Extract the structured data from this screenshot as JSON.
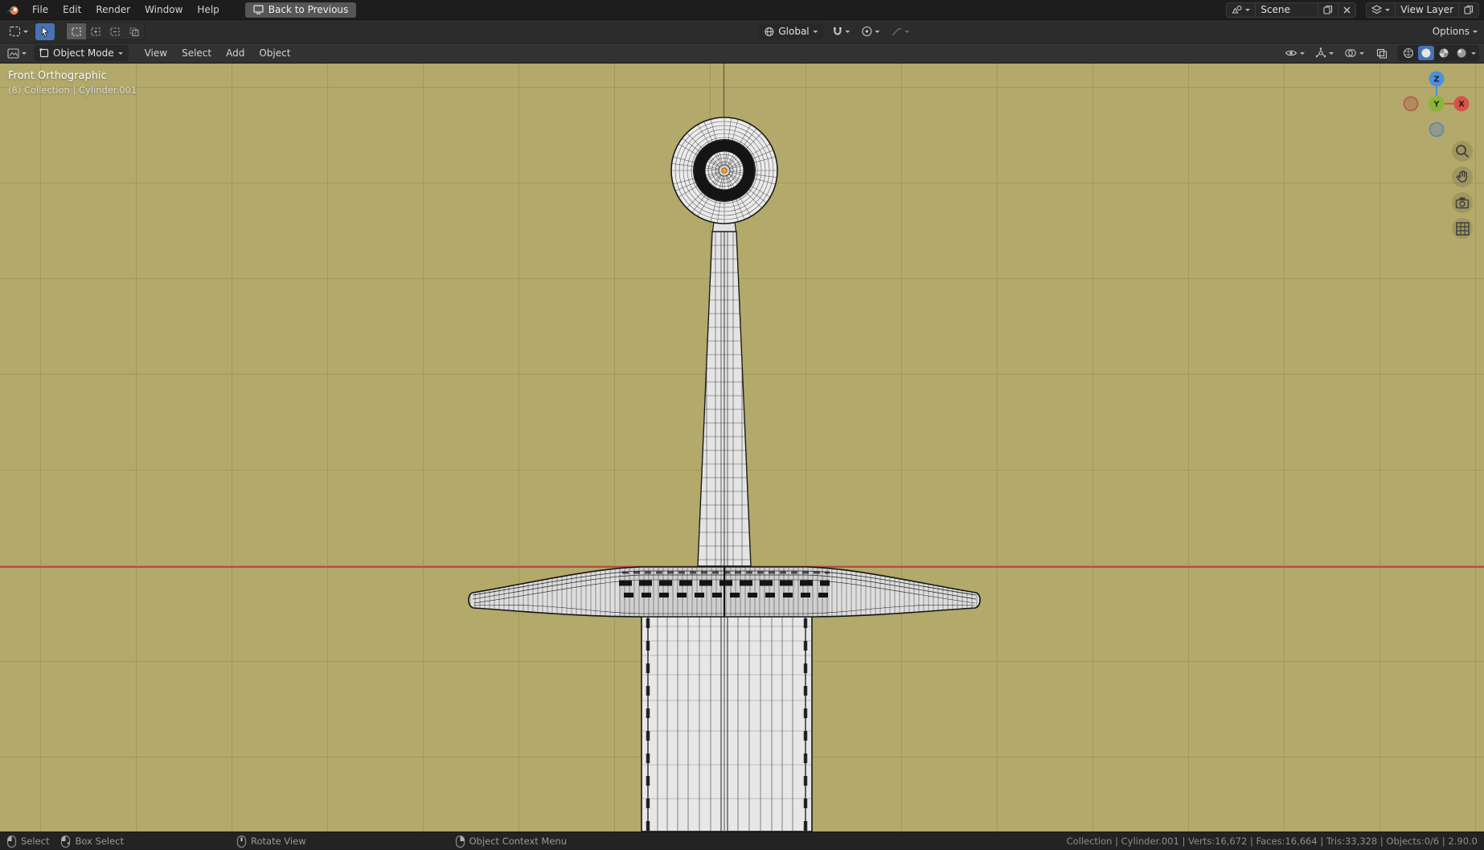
{
  "theme": {
    "topbar-bg": "#1d1d1d",
    "toolbar-bg": "#2c2c2c",
    "header-bg": "#323232",
    "status-bg": "#232323",
    "vp-bg": "#b2a96a",
    "grid": "#a19858",
    "axis-red": "#bb4a44",
    "accent": "#4772b3"
  },
  "topbar": {
    "menus": [
      {
        "label": "File"
      },
      {
        "label": "Edit"
      },
      {
        "label": "Render"
      },
      {
        "label": "Window"
      },
      {
        "label": "Help"
      }
    ],
    "back_button": "Back to Previous",
    "scene": {
      "value": "Scene"
    },
    "view_layer": {
      "value": "View Layer"
    }
  },
  "tool_settings": {
    "orientation": {
      "value": "Global"
    },
    "options": "Options"
  },
  "viewport_header": {
    "mode": "Object Mode",
    "menus": [
      {
        "label": "View"
      },
      {
        "label": "Select"
      },
      {
        "label": "Add"
      },
      {
        "label": "Object"
      }
    ]
  },
  "viewport": {
    "view_label": "Front Orthographic",
    "breadcrumb": "(8) Collection | Cylinder.001",
    "gizmo": {
      "x": "X",
      "y": "Y",
      "z": "Z"
    }
  },
  "status_bar": {
    "hints": [
      {
        "label": "Select"
      },
      {
        "label": "Box Select"
      },
      {
        "label": "Rotate View"
      },
      {
        "label": "Object Context Menu"
      }
    ],
    "stats": "Collection | Cylinder.001 | Verts:16,672 | Faces:16,664 | Tris:33,328 | Objects:0/6 | 2.90.0"
  }
}
